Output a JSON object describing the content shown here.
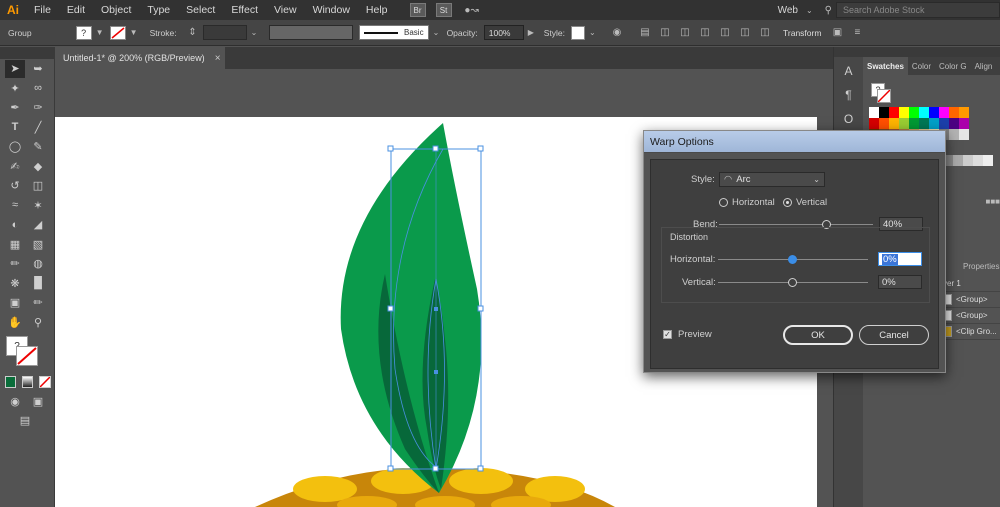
{
  "app": {
    "logo": "Ai",
    "workspace": "Web",
    "search_placeholder": "Search Adobe Stock"
  },
  "menu": [
    "File",
    "Edit",
    "Object",
    "Type",
    "Select",
    "Effect",
    "View",
    "Window",
    "Help"
  ],
  "menu_badges": [
    "Br",
    "St"
  ],
  "control": {
    "selection": "Group",
    "fill_glyph": "?",
    "stroke_label": "Stroke:",
    "brush": "Basic",
    "opacity_label": "Opacity:",
    "opacity_value": "100%",
    "style_label": "Style:",
    "transform_label": "Transform"
  },
  "document": {
    "tab_title": "Untitled-1* @ 200% (RGB/Preview)",
    "close_glyph": "×"
  },
  "swatches_panel": {
    "tabs": [
      "Swatches",
      "Color",
      "Color G",
      "Align"
    ],
    "unknown_glyph": "?",
    "colors": [
      [
        "#ffffff",
        "#000000",
        "#ff0000",
        "#ffff00",
        "#00ff00",
        "#00ffff",
        "#0000ff",
        "#ff00ff",
        "#ff6600",
        "#ff9900"
      ],
      [
        "#d40000",
        "#ff4f00",
        "#ffb300",
        "#9acd32",
        "#009933",
        "#007755",
        "#00a0c8",
        "#1c3faa",
        "#4b0082",
        "#aa00aa"
      ],
      [
        "#663300",
        "#7a4a1f",
        "#a0522d",
        "#b07a3f",
        "#c8a060",
        "#e3c58d",
        "#f0e0b0",
        "#808080",
        "#b3b3b3",
        "#e6e6e6"
      ]
    ]
  },
  "layers_panel": {
    "tab": "Properties",
    "rows": [
      "yer 1",
      "<Group>",
      "<Group>",
      "<Clip Gro..."
    ]
  },
  "warp": {
    "title": "Warp Options",
    "style_label": "Style:",
    "style_value": "Arc",
    "horizontal": "Horizontal",
    "vertical": "Vertical",
    "orientation": "Vertical",
    "bend_label": "Bend:",
    "bend_value": "40%",
    "bend_level": 0.7,
    "distortion_label": "Distortion",
    "dist_h_label": "Horizontal:",
    "dist_h_value": "0%",
    "dist_h_level": 0.5,
    "dist_v_label": "Vertical:",
    "dist_v_value": "0%",
    "dist_v_level": 0.5,
    "preview_label": "Preview",
    "preview_checked": true,
    "ok": "OK",
    "cancel": "Cancel"
  },
  "colors": {
    "leaf_main": "#0a9a4b",
    "leaf_dark": "#07683a",
    "pineapple": "#f3c00e",
    "pineapple_dark": "#c8860a",
    "selection": "#4a90e2"
  }
}
